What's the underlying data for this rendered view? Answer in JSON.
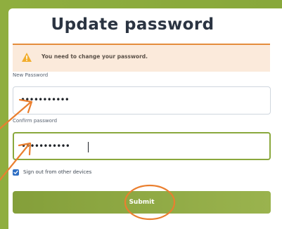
{
  "page": {
    "title": "Update password"
  },
  "alert": {
    "message": "You need to change your password.",
    "icon": "warning-icon"
  },
  "form": {
    "new_password": {
      "label": "New Password",
      "value": "•••••••••••"
    },
    "confirm_password": {
      "label": "Confirm password",
      "value": "•••••••••••"
    },
    "sign_out_option": {
      "label": "Sign out from other devices",
      "checked": true
    },
    "submit_label": "Submit"
  },
  "colors": {
    "brand_green": "#8aa83d",
    "alert_orange": "#e48d3c",
    "checkbox_blue": "#2f6fc4"
  }
}
